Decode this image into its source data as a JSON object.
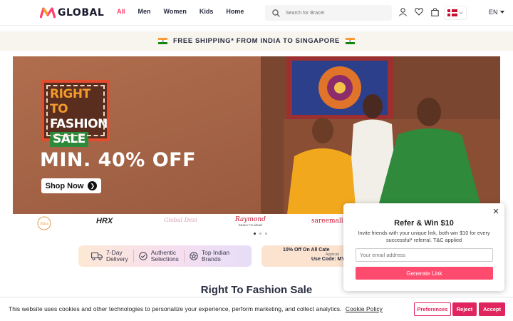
{
  "header": {
    "logo_text": "GLOBAL",
    "nav": [
      {
        "label": "All",
        "active": true
      },
      {
        "label": "Men",
        "active": false
      },
      {
        "label": "Women",
        "active": false
      },
      {
        "label": "Kids",
        "active": false
      },
      {
        "label": "Home",
        "active": false
      }
    ],
    "search_placeholder": "Search for Bracel",
    "language": "EN",
    "icons": [
      "user-icon",
      "heart-icon",
      "bag-icon"
    ],
    "region_flag": "denmark-flag-icon"
  },
  "shipping_banner": {
    "text": "FREE SHIPPING* FROM INDIA TO SINGAPORE"
  },
  "hero": {
    "stamp_lines": [
      "RIGHT TO",
      "FASHION",
      "SALE"
    ],
    "headline": "MIN. 40% OFF",
    "cta": "Shop Now",
    "carousel_pages": 3,
    "carousel_active": 1
  },
  "brands": [
    {
      "label": "Biba",
      "color": "#e3a04a"
    },
    {
      "label": "HRX",
      "color": "#222222"
    },
    {
      "label": "Global Desi",
      "color": "#d6a2b4"
    },
    {
      "label": "Raymond",
      "sub": "READY TO WEAR",
      "color": "#c8102e"
    },
    {
      "label": "sareemall",
      "color": "#c8102e"
    }
  ],
  "features": [
    {
      "icon": "truck-icon",
      "line1": "7-Day",
      "line2": "Delivery"
    },
    {
      "icon": "check-circle-icon",
      "line1": "Authentic",
      "line2": "Selections"
    },
    {
      "icon": "brand-tag-icon",
      "line1": "Top Indian",
      "line2": "Brands"
    }
  ],
  "offer_strip": {
    "line1": "10% Off On All Cate",
    "line2": "Applicab",
    "line3": "Use Code: MY"
  },
  "section_title": "Right To Fashion Sale",
  "refer_popup": {
    "title": "Refer & Win $10",
    "description": "Invite friends with your unique link, both win $10 for every successful* referral. T&C applied",
    "email_placeholder": "Your email address",
    "button": "Generate Link"
  },
  "cookie_bar": {
    "text": "This website uses cookies and other technologies to personalize your experience, perform marketing, and collect analytics.",
    "link": "Cookie Policy",
    "preferences": "Preferences",
    "reject": "Reject",
    "accept": "Accept"
  },
  "colors": {
    "accent": "#ff3f6c",
    "cookie_button": "#e0245e",
    "banner_bg": "#a8684a",
    "stamp_border": "#e44c2e"
  }
}
